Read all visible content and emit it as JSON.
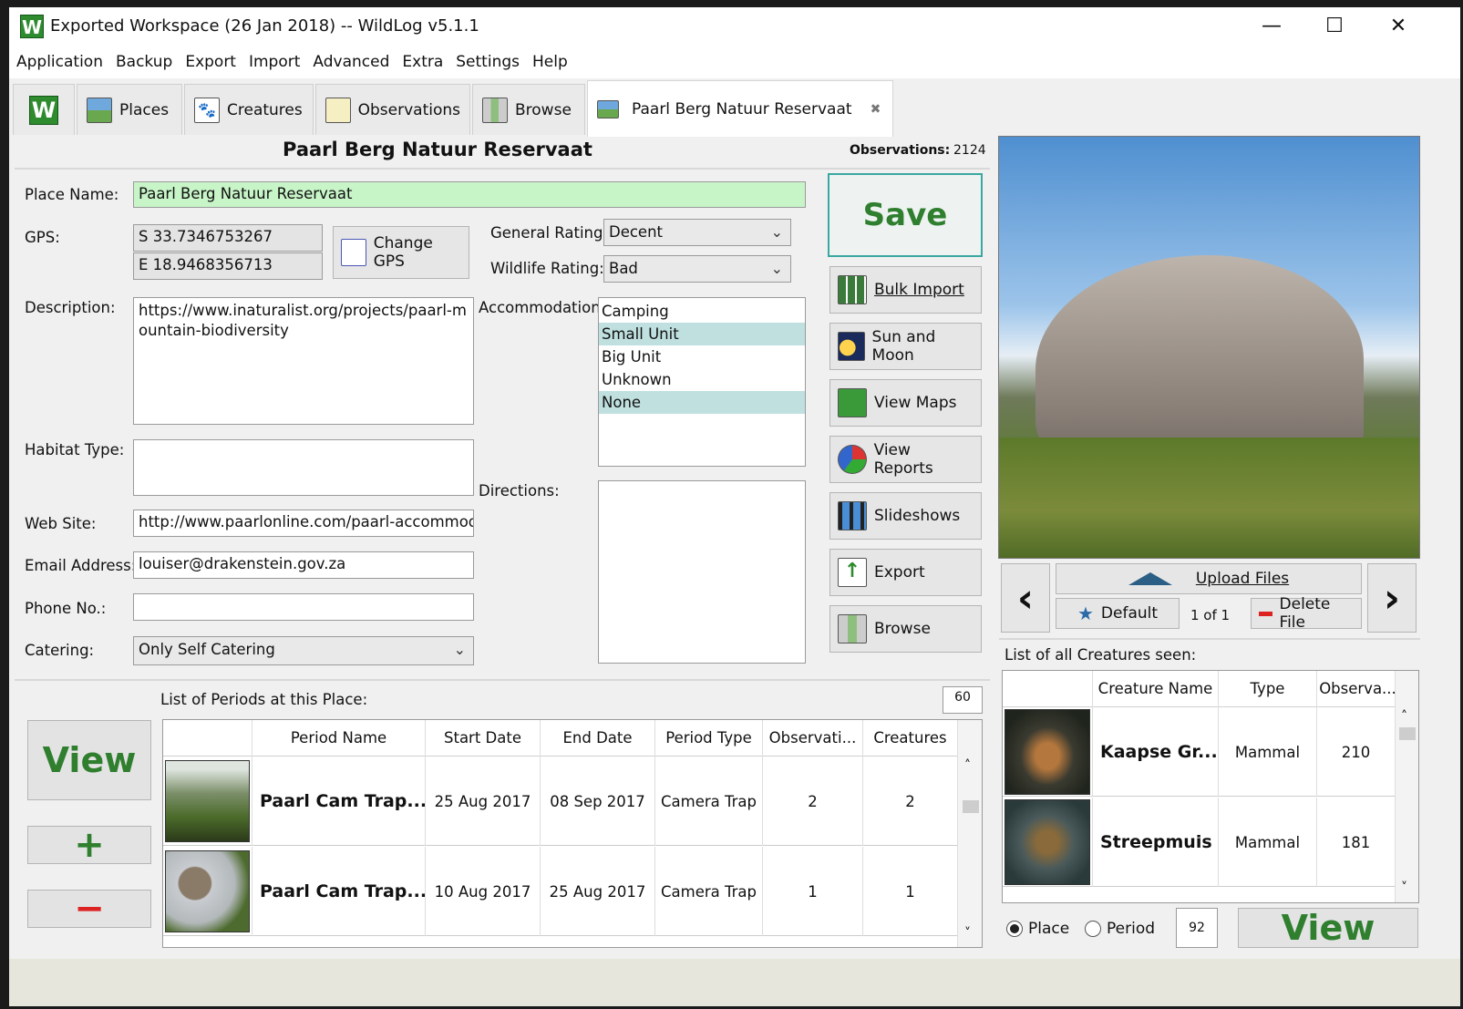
{
  "window": {
    "title": "Exported Workspace (26 Jan 2018) -- WildLog v5.1.1",
    "logo": "W",
    "controls": [
      "—",
      "☐",
      "✕"
    ]
  },
  "menu": [
    "Application",
    "Backup",
    "Export",
    "Import",
    "Advanced",
    "Extra",
    "Settings",
    "Help"
  ],
  "tabs": {
    "home_logo": "W",
    "items": [
      {
        "label": "Places",
        "icon": "places-icon"
      },
      {
        "label": "Creatures",
        "icon": "creatures-icon"
      },
      {
        "label": "Observations",
        "icon": "observations-icon"
      },
      {
        "label": "Browse",
        "icon": "browse-icon"
      }
    ],
    "active": {
      "label": "Paarl Berg Natuur Reservaat",
      "close": "✖"
    }
  },
  "header": {
    "title": "Paarl Berg Natuur Reservaat",
    "observations_label": "Observations:",
    "observations_count": "2124"
  },
  "form": {
    "place_name_label": "Place Name:",
    "place_name": "Paarl Berg Natuur Reservaat",
    "gps_label": "GPS:",
    "gps_lat": "S 33.7346753267",
    "gps_lon": "E 18.9468356713",
    "change_gps": "Change GPS",
    "general_rating_label": "General Rating:",
    "general_rating": "Decent",
    "wildlife_rating_label": "Wildlife Rating:",
    "wildlife_rating": "Bad",
    "description_label": "Description:",
    "description": "https://www.inaturalist.org/projects/paarl-mountain-biodiversity",
    "accommodation_label": "Accommodation:",
    "accommodation_options": [
      "Camping",
      "Small Unit",
      "Big Unit",
      "Unknown",
      "None"
    ],
    "accommodation_selected": [
      "Small Unit",
      "None"
    ],
    "habitat_label": "Habitat Type:",
    "habitat": "",
    "directions_label": "Directions:",
    "directions": "",
    "website_label": "Web Site:",
    "website": "http://www.paarlonline.com/paarl-accommodation",
    "email_label": "Email Address:",
    "email": "louiser@drakenstein.gov.za",
    "phone_label": "Phone No.:",
    "phone": "",
    "catering_label": "Catering:",
    "catering": "Only Self Catering"
  },
  "actions": {
    "save": "Save",
    "buttons": [
      {
        "label": "Bulk Import",
        "icon": "bulk-import-icon",
        "underline": true
      },
      {
        "label": "Sun and Moon",
        "icon": "sun-moon-icon"
      },
      {
        "label": "View Maps",
        "icon": "map-icon"
      },
      {
        "label": "View Reports",
        "icon": "pie-chart-icon"
      },
      {
        "label": "Slideshows",
        "icon": "filmstrip-icon"
      },
      {
        "label": "Export",
        "icon": "export-arrow-icon"
      },
      {
        "label": "Browse",
        "icon": "browse-icon"
      }
    ]
  },
  "periods": {
    "label": "List of Periods at this Place:",
    "count": "60",
    "view": "View",
    "add": "+",
    "remove": "−",
    "columns": [
      "Period Name",
      "Start Date",
      "End Date",
      "Period Type",
      "Observati...",
      "Creatures"
    ],
    "rows": [
      {
        "name": "Paarl Cam Trap...",
        "start": "25 Aug 2017",
        "end": "08 Sep 2017",
        "type": "Camera Trap",
        "observations": "2",
        "creatures": "2"
      },
      {
        "name": "Paarl Cam Trap...",
        "start": "10 Aug 2017",
        "end": "25 Aug 2017",
        "type": "Camera Trap",
        "observations": "1",
        "creatures": "1"
      }
    ]
  },
  "image_panel": {
    "upload": "Upload Files",
    "default": "Default",
    "counter": "1 of 1",
    "delete": "Delete File",
    "prev": "‹",
    "next": "›"
  },
  "creatures": {
    "label": "List of all Creatures seen:",
    "columns": [
      "Creature Name",
      "Type",
      "Observa..."
    ],
    "rows": [
      {
        "name": "Kaapse Gr...",
        "type": "Mammal",
        "observations": "210"
      },
      {
        "name": "Streepmuis",
        "type": "Mammal",
        "observations": "181"
      }
    ],
    "filter_place": "Place",
    "filter_period": "Period",
    "count": "92",
    "view": "View"
  },
  "colors": {
    "accent_green": "#2f7f2f",
    "place_name_bg": "#c8f5c8",
    "list_selection": "#bfe0df",
    "save_border": "#3aa7a0"
  }
}
